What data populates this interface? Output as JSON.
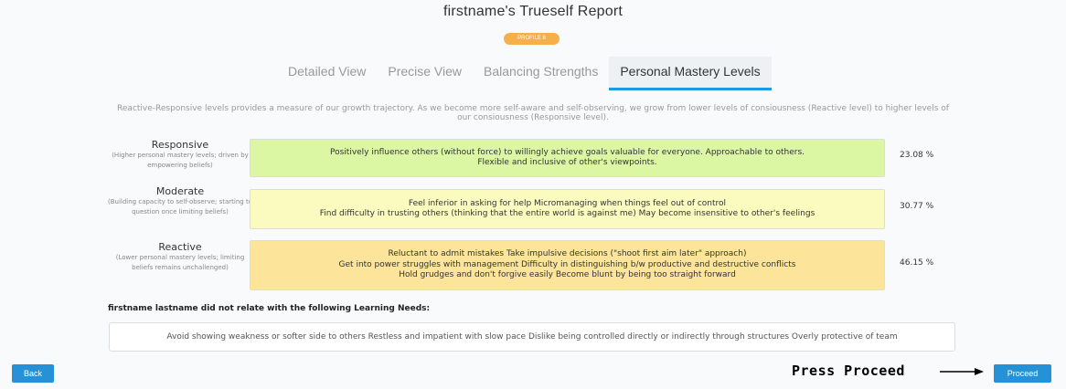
{
  "header": {
    "title": "firstname's Trueself Report",
    "badge": "PROFILE 8"
  },
  "tabs": [
    {
      "label": "Detailed View",
      "active": false
    },
    {
      "label": "Precise View",
      "active": false
    },
    {
      "label": "Balancing Strengths",
      "active": false
    },
    {
      "label": "Personal Mastery Levels",
      "active": true
    }
  ],
  "intro": "Reactive-Responsive levels provides a measure of our growth trajectory. As we become more self-aware and self-observing, we grow from lower levels of consiousness (Reactive level) to higher levels of our consiousness (Responsive level).",
  "levels": [
    {
      "name": "Responsive",
      "desc": "(Higher personal mastery levels; driven by empowering beliefs)",
      "lines": [
        "Positively influence others (without force) to willingly achieve goals valuable for everyone.   Approachable to others.",
        "Flexible and inclusive of other's viewpoints."
      ],
      "percent": "23.08 %",
      "color": "#dcf7a4"
    },
    {
      "name": "Moderate",
      "desc": "(Building capacity to self-observe; starting to question once limiting beliefs)",
      "lines": [
        "Feel inferior in asking for help   Micromanaging when things feel out of control",
        "Find difficulty in trusting others (thinking that the entire world is against me)   May become insensitive to other's feelings"
      ],
      "percent": "30.77 %",
      "color": "#fbfbbf"
    },
    {
      "name": "Reactive",
      "desc": "(Lower personal mastery levels; limiting beliefs remains unchallenged)",
      "lines": [
        "Reluctant to admit mistakes   Take impulsive decisions (\"shoot first aim later\" approach)",
        "Get into power struggles with management   Difficulty in distinguishing b/w productive and destructive conflicts",
        "Hold grudges and don't forgive easily   Become blunt by being too straight forward"
      ],
      "percent": "46.15 %",
      "color": "#fce49a"
    }
  ],
  "needs": {
    "heading": "firstname lastname did not relate with the following Learning Needs:",
    "text": "Avoid showing weakness or softer side to others   Restless and impatient with slow pace   Dislike being controlled directly or indirectly through structures   Overly protective of team"
  },
  "buttons": {
    "back": "Back",
    "proceed": "Proceed"
  },
  "annotation": "Press Proceed"
}
